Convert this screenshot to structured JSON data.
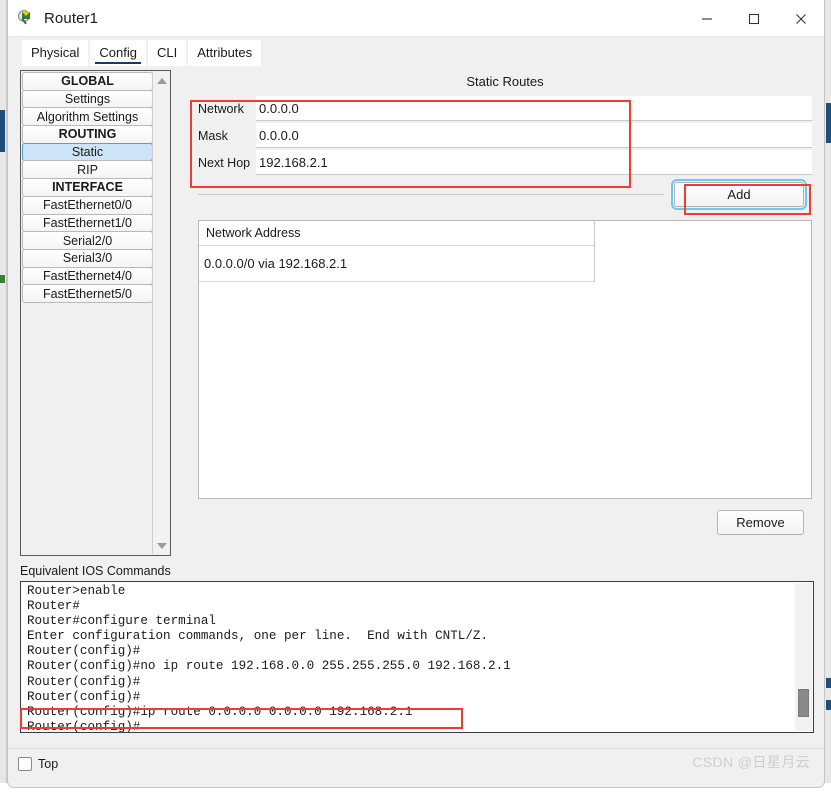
{
  "window": {
    "title": "Router1",
    "icon": "router-icon",
    "controls": {
      "minimize": "—",
      "maximize": "□",
      "close": "✕"
    }
  },
  "tabs": [
    {
      "label": "Physical",
      "active": false
    },
    {
      "label": "Config",
      "active": true
    },
    {
      "label": "CLI",
      "active": false
    },
    {
      "label": "Attributes",
      "active": false
    }
  ],
  "sidebar": {
    "items": [
      {
        "label": "GLOBAL",
        "type": "group"
      },
      {
        "label": "Settings",
        "type": "item"
      },
      {
        "label": "Algorithm Settings",
        "type": "item"
      },
      {
        "label": "ROUTING",
        "type": "group"
      },
      {
        "label": "Static",
        "type": "item",
        "selected": true
      },
      {
        "label": "RIP",
        "type": "item"
      },
      {
        "label": "INTERFACE",
        "type": "group"
      },
      {
        "label": "FastEthernet0/0",
        "type": "item"
      },
      {
        "label": "FastEthernet1/0",
        "type": "item"
      },
      {
        "label": "Serial2/0",
        "type": "item"
      },
      {
        "label": "Serial3/0",
        "type": "item"
      },
      {
        "label": "FastEthernet4/0",
        "type": "item"
      },
      {
        "label": "FastEthernet5/0",
        "type": "item"
      }
    ]
  },
  "main": {
    "section_title": "Static Routes",
    "fields": {
      "network_label": "Network",
      "network_value": "0.0.0.0",
      "mask_label": "Mask",
      "mask_value": "0.0.0.0",
      "nexthop_label": "Next Hop",
      "nexthop_value": "192.168.2.1"
    },
    "add_button": "Add",
    "remove_button": "Remove",
    "routes_table": {
      "header": "Network Address",
      "rows": [
        "0.0.0.0/0 via 192.168.2.1"
      ]
    }
  },
  "ios": {
    "label": "Equivalent IOS Commands",
    "lines": "Router>enable\nRouter#\nRouter#configure terminal\nEnter configuration commands, one per line.  End with CNTL/Z.\nRouter(config)#\nRouter(config)#no ip route 192.168.0.0 255.255.255.0 192.168.2.1\nRouter(config)#\nRouter(config)#\nRouter(config)#ip route 0.0.0.0 0.0.0.0 192.168.2.1\nRouter(config)#"
  },
  "footer": {
    "top_checkbox_label": "Top",
    "top_checked": false,
    "watermark": "CSDN @日星月云"
  },
  "annotations": {
    "color": "#ee3b33",
    "boxes": [
      {
        "name": "static-route-fields-highlight"
      },
      {
        "name": "add-button-highlight"
      },
      {
        "name": "ip-route-command-highlight"
      }
    ]
  }
}
